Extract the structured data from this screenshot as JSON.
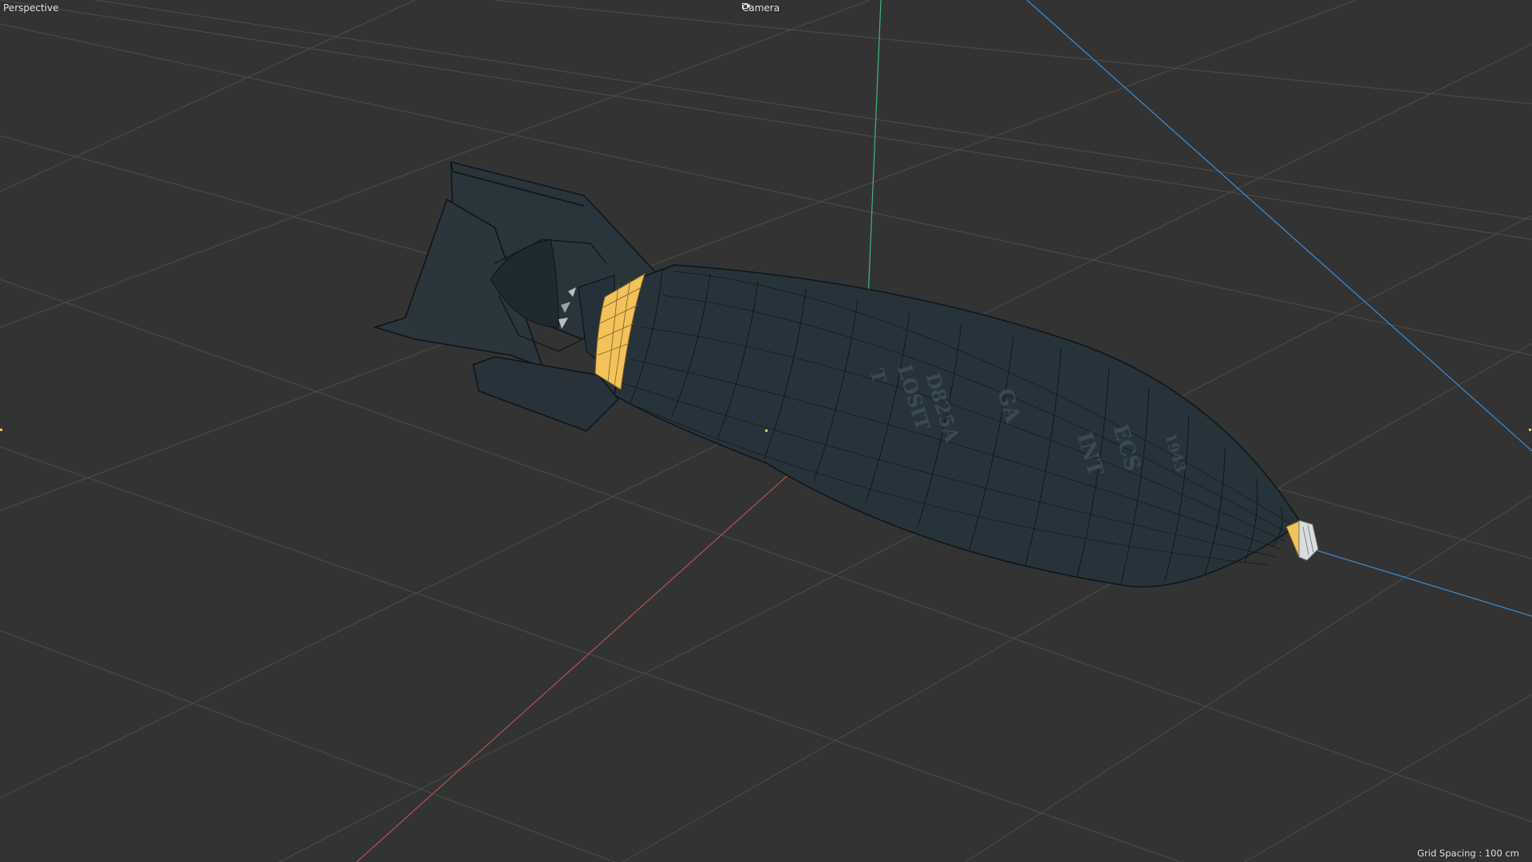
{
  "viewport": {
    "view_name": "Perspective",
    "camera_label": "Camera",
    "camera_icon": "camera-icon",
    "grid_spacing_text": "Grid Spacing : 100 cm",
    "colors": {
      "background": "#333333",
      "grid_line": "#4d4d4d",
      "axis_x": "#c65a5a",
      "axis_y": "#3fb77a",
      "axis_z": "#3c8fd6",
      "model_body": "#27333a",
      "wireframe": "#0e1418",
      "selection_highlight": "#f2c25b",
      "hud_text": "#e6e6e6"
    }
  },
  "model": {
    "object": "bomb",
    "stencil_text": [
      "INT",
      "ECS",
      "GA",
      "D825A",
      "LOSIT",
      "T",
      "1943"
    ]
  }
}
